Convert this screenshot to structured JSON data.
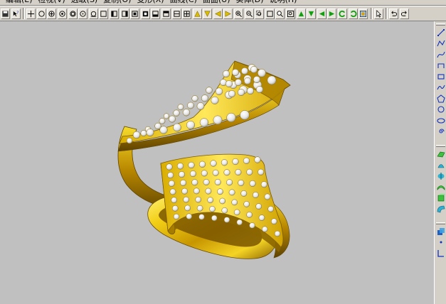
{
  "menubar": {
    "items": [
      "编辑(E)",
      "检视(V)",
      "选取(S)",
      "复制(O)",
      "变形(X)",
      "曲线(C)",
      "曲面(U)",
      "实体(D)",
      "说明(H)"
    ]
  },
  "toolbar": {
    "buttons": [
      {
        "icon": "save-icon"
      },
      {
        "icon": "help-pointer-icon"
      },
      {
        "sep": true
      },
      {
        "icon": "point-icon"
      },
      {
        "icon": "circle-icon"
      },
      {
        "icon": "snap-center-icon"
      },
      {
        "icon": "snap-end-icon"
      },
      {
        "icon": "snap-near-icon"
      },
      {
        "icon": "snap-mid-icon"
      },
      {
        "icon": "snap-tangent-icon"
      },
      {
        "icon": "box-icon"
      },
      {
        "icon": "view-front-icon"
      },
      {
        "icon": "view-back-icon"
      },
      {
        "icon": "view-top-icon"
      },
      {
        "icon": "view-bottom-icon"
      },
      {
        "icon": "view-left-icon"
      },
      {
        "icon": "view-right-icon"
      },
      {
        "icon": "split-view-icon"
      },
      {
        "icon": "four-view-icon"
      },
      {
        "icon": "triangle-up-icon"
      },
      {
        "icon": "triangle-down-icon"
      },
      {
        "icon": "arrow-left-icon"
      },
      {
        "icon": "arrow-right-icon"
      },
      {
        "icon": "zoom-in-icon"
      },
      {
        "icon": "zoom-out-icon"
      },
      {
        "icon": "zoom-window-icon"
      },
      {
        "icon": "zoom-extent-icon"
      },
      {
        "icon": "zoom-selected-icon"
      },
      {
        "icon": "zoom-all-icon"
      },
      {
        "icon": "green-up-icon"
      },
      {
        "icon": "green-down-icon"
      },
      {
        "icon": "green-left-icon"
      },
      {
        "icon": "green-right-icon"
      },
      {
        "icon": "rotate-ccw-icon"
      },
      {
        "icon": "rotate-cw-icon"
      },
      {
        "icon": "render-icon"
      },
      {
        "sep": true
      },
      {
        "icon": "select-pointer-icon"
      },
      {
        "sep": true
      },
      {
        "icon": "undo-icon"
      },
      {
        "icon": "redo-icon"
      }
    ]
  },
  "side_toolbar": {
    "groups": [
      [
        "line-icon",
        "polyline-icon",
        "curve-icon",
        "arc-icon",
        "rectangle-icon",
        "free-curve-icon",
        "polygon-icon",
        "circle-tool-icon",
        "ellipse-icon",
        "spiral-icon"
      ],
      [
        "surface-icon",
        "loft-icon",
        "revolve-icon",
        "sweep-icon",
        "extrude-icon",
        "blend-icon"
      ],
      [
        "solid-box-icon",
        "dot-icon",
        "dimension-icon"
      ]
    ]
  },
  "colors": {
    "background": "#c0c0c0",
    "toolbar": "#d4d0c8",
    "gold": "#e8c21a",
    "gold_dark": "#7a5a00",
    "diamond": "#f2f2f2"
  }
}
